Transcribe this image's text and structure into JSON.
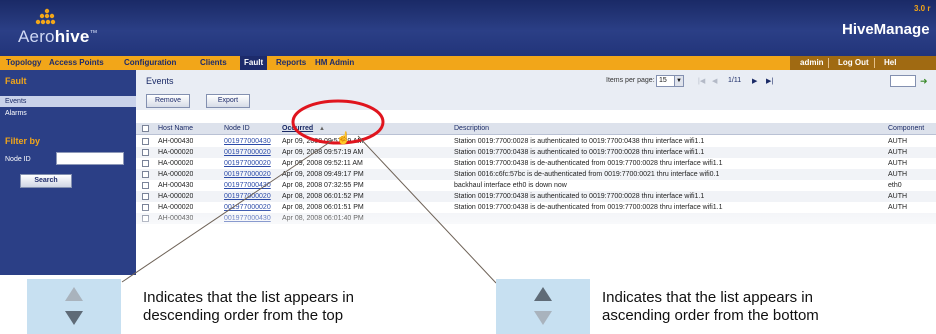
{
  "header": {
    "brand_prefix": "Aero",
    "brand_suffix": "hive",
    "brand_mark": "™",
    "version": "3.0 r",
    "product_title": "HiveManage"
  },
  "menu": {
    "items": [
      "Topology",
      "Access Points",
      "Configuration",
      "Clients",
      "Fault",
      "Reports",
      "HM Admin"
    ],
    "active": "Fault",
    "user": "admin",
    "logout": "Log Out",
    "help": "Hel"
  },
  "sidebar": {
    "section_title": "Fault",
    "items": [
      "Events",
      "Alarms"
    ],
    "active_item": "Events",
    "filter_title": "Filter by",
    "filter_label": "Node ID",
    "filter_value": "",
    "search_button": "Search"
  },
  "content": {
    "title": "Events",
    "buttons": [
      "Remove",
      "Export"
    ],
    "items_per_page_label": "Items per page:",
    "items_per_page_value": "15",
    "page_indicator": "1/11",
    "page_input_value": ""
  },
  "table": {
    "columns": [
      "Host Name",
      "Node ID",
      "Occurred",
      "Description",
      "Component"
    ],
    "sort_column": "Occurred",
    "rows": [
      [
        "AH-000430",
        "001977000430",
        "Apr 09, 2008 09:57:19 AM",
        "Station 0019:7700:0028 is authenticated to 0019:7700:0438 thru interface wifi1.1",
        "AUTH"
      ],
      [
        "HA-000020",
        "001977000020",
        "Apr 09, 2008 09:57:19 AM",
        "Station 0019:7700:0438 is authenticated to 0019:7700:0028 thru interface wifi1.1",
        "AUTH"
      ],
      [
        "HA-000020",
        "001977000020",
        "Apr 09, 2008 09:52:11 AM",
        "Station 0019:7700:0438 is de-authenticated from 0019:7700:0028 thru interface wifi1.1",
        "AUTH"
      ],
      [
        "HA-000020",
        "001977000020",
        "Apr 09, 2008 09:49:17 PM",
        "Station 0016:c6fc:57bc is de-authenticated from 0019:7700:0021 thru interface wifi0.1",
        "AUTH"
      ],
      [
        "AH-000430",
        "001977000430",
        "Apr 08, 2008 07:32:55 PM",
        "backhaul interface eth0 is down now",
        "eth0"
      ],
      [
        "HA-000020",
        "001977000020",
        "Apr 08, 2008 06:01:52 PM",
        "Station 0019:7700:0438 is authenticated to 0019:7700:0028 thru interface wifi1.1",
        "AUTH"
      ],
      [
        "HA-000020",
        "001977000020",
        "Apr 08, 2008 06:01:51 PM",
        "Station 0019:7700:0438 is de-authenticated from 0019:7700:0028 thru interface wifi1.1",
        "AUTH"
      ],
      [
        "AH-000430",
        "001977000430",
        "Apr 08, 2008 06:01:40 PM",
        "",
        ""
      ]
    ]
  },
  "annotations": {
    "descending": "Indicates that the list appears in descending order from the top",
    "descending_line1": "Indicates that the list appears in",
    "descending_line2": "descending order from the top",
    "ascending_line1": "Indicates that the list appears in",
    "ascending_line2": "ascending order from the bottom",
    "callout_color": "#e0151e",
    "legend_color": "#c7e0f1"
  },
  "colors": {
    "header_blue": "#2b3f86",
    "menu_orange": "#f2a619",
    "link_blue": "#2b4aa8"
  }
}
